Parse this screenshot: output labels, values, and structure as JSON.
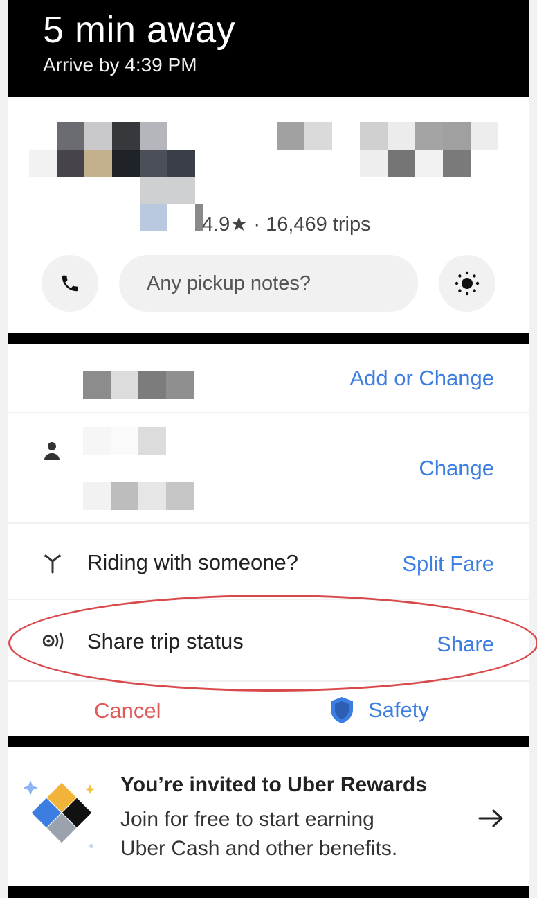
{
  "header": {
    "eta": "5 min away",
    "arrive": "Arrive by 4:39 PM"
  },
  "driver": {
    "rating": "4.9★ · 16,469 trips",
    "notes_placeholder": "Any pickup notes?",
    "icons": [
      "phone-icon",
      "brightness-icon"
    ]
  },
  "rows": {
    "destination_action": "Add or Change",
    "rider_action": "Change",
    "split_label": "Riding with someone?",
    "split_action": "Split Fare",
    "share_label": "Share trip status",
    "share_action": "Share"
  },
  "footer": {
    "cancel": "Cancel",
    "safety": "Safety"
  },
  "rewards": {
    "title": "You’re invited to Uber Rewards",
    "line1": "Join for free to start earning",
    "line2": "Uber Cash and other benefits."
  },
  "colors": {
    "accent_blue": "#3b7de0",
    "cancel_red": "#e05a5a",
    "highlight_red": "#d8494b"
  }
}
